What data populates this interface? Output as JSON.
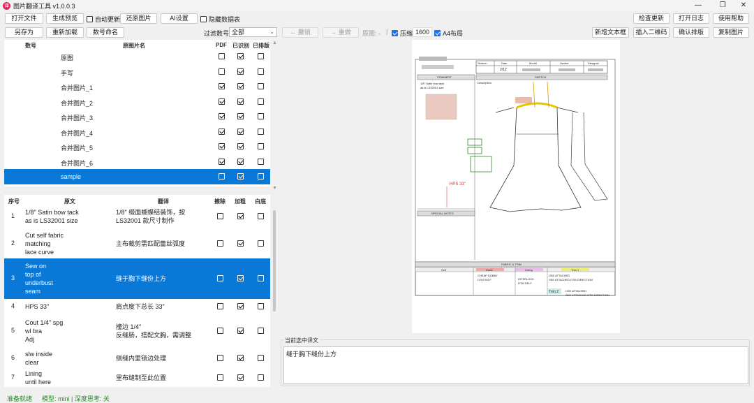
{
  "app": {
    "title": "图片翻译工具 v1.0.0.3"
  },
  "toolbar1": {
    "open_file": "打开文件",
    "generate_preview": "生成预览",
    "auto_update": "自动更新",
    "restore_image": "还原图片",
    "ai_settings": "AI设置",
    "hide_table": "隐藏数据表",
    "check_update": "检查更新",
    "open_log": "打开日志",
    "help": "使用帮助"
  },
  "toolbar2": {
    "save_as": "另存为",
    "reload": "重新加载",
    "number_rename": "数号命名",
    "filter_label": "过滤数号:",
    "filter_value": "全部",
    "undo": "← 撤销",
    "redo": "→ 重做",
    "original_label": "原图: ◦",
    "compress": "压缩",
    "compress_value": "1600",
    "a4_layout": "A4布局",
    "new_textbox": "新增文本框",
    "insert_qr": "插入二维码",
    "confirm_layout": "确认排版",
    "copy_image": "复制图片"
  },
  "image_table": {
    "headers": {
      "num": "数号",
      "name": "原图片名",
      "pdf": "PDF",
      "recognized": "已识别",
      "typeset": "已排版"
    },
    "rows": [
      {
        "name": "原图",
        "pdf": false,
        "recognized": true,
        "typeset": false
      },
      {
        "name": "手写",
        "pdf": false,
        "recognized": true,
        "typeset": false
      },
      {
        "name": "合并图片_1",
        "pdf": true,
        "recognized": true,
        "typeset": false
      },
      {
        "name": "合并图片_2",
        "pdf": true,
        "recognized": true,
        "typeset": false
      },
      {
        "name": "合并图片_3",
        "pdf": true,
        "recognized": true,
        "typeset": false
      },
      {
        "name": "合并图片_4",
        "pdf": true,
        "recognized": true,
        "typeset": false
      },
      {
        "name": "合并图片_5",
        "pdf": true,
        "recognized": true,
        "typeset": false
      },
      {
        "name": "合并图片_6",
        "pdf": true,
        "recognized": true,
        "typeset": false
      },
      {
        "name": "sample",
        "pdf": false,
        "recognized": true,
        "typeset": false,
        "selected": true
      }
    ]
  },
  "trans_table": {
    "headers": {
      "seq": "序号",
      "source": "原文",
      "translation": "翻译",
      "erase": "擦除",
      "bold": "加粗",
      "white_bg": "白底"
    },
    "rows": [
      {
        "seq": "1",
        "source": "1/8\" Satin bow tack\nas is LS32001 size",
        "translation": "1/8\" 缎面蝴蝶结装饰，按\nLS32001 款尺寸制作",
        "erase": false,
        "bold": true,
        "white": false
      },
      {
        "seq": "2",
        "source": "Cut self fabric\nmatching\nlace curve",
        "translation": "主布裁剪需匹配蕾丝弧度",
        "erase": false,
        "bold": true,
        "white": false
      },
      {
        "seq": "3",
        "source": "Sew on\ntop of\nunderbust\nseam",
        "translation": "缝于胸下缝份上方",
        "erase": false,
        "bold": true,
        "white": false,
        "selected": true
      },
      {
        "seq": "4",
        "source": "HPS 33\"",
        "translation": "肩点度下总长 33\"",
        "erase": false,
        "bold": true,
        "white": false
      },
      {
        "seq": "5",
        "source": "Cout 1/4\" spg\nwl bra\nAdj",
        "translation": "撞边 1/4\"\n反缝肠，搭配文胸，需调整",
        "erase": false,
        "bold": true,
        "white": false
      },
      {
        "seq": "6",
        "source": "slw inside\nclear",
        "translation": "侧缝内里锁边处理",
        "erase": false,
        "bold": true,
        "white": false
      },
      {
        "seq": "7",
        "source": "Lining\nuntil here",
        "translation": "里布缝制至此位置",
        "erase": false,
        "bold": true,
        "white": false
      }
    ]
  },
  "current_translation": {
    "label": "当前选中译文",
    "text": "缝于胸下缝份上方"
  },
  "sketch": {
    "season": "Season",
    "date": "Date",
    "model": "Model",
    "vendor": "Vendor",
    "designer": "Designer",
    "date_value": "2/12",
    "comment": "COMMENT",
    "sketch": "SKETCH",
    "description": "Description",
    "bow_note": "1/8\" Satin bow tack\nas is LS32001 size",
    "special_notes": "SPECIAL NOTES",
    "fabric_trim": "FABRIC & TRIM",
    "self": "Self",
    "contr": "Contr",
    "lining": "Lining",
    "trim1": "Trim 1",
    "cheap_dobby": "CHEAP DOBBY\nDTM SELF",
    "interlock": "INTERLOCK\nDTM SELF",
    "use_attached": "USE ATTACHED\nSEE ATTACHED DTM DIRECTION",
    "trim2": "Trim 2",
    "use_attached2": "USE ATTACHED\nSEE ATTACHED DTM DIRECTION"
  },
  "status": {
    "ready": "准备就绪",
    "model_info": "模型: mini | 深度思考: 关"
  }
}
